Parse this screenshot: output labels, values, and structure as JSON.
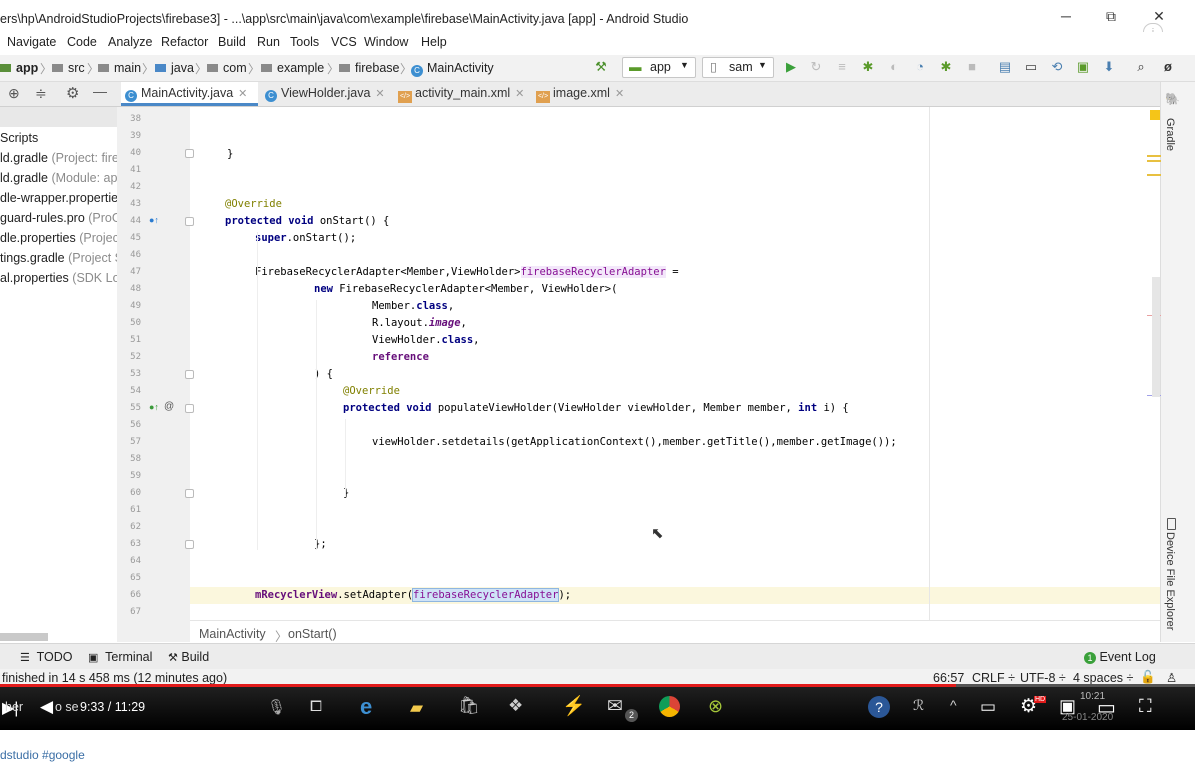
{
  "window": {
    "title": "ers\\hp\\AndroidStudioProjects\\firebase3] - ...\\app\\src\\main\\java\\com\\example\\firebase\\MainActivity.java [app] - Android Studio",
    "minimize": "─",
    "restore": "⧉",
    "close": "✕"
  },
  "menu": [
    "Navigate",
    "Code",
    "Analyze",
    "Refactor",
    "Build",
    "Run",
    "Tools",
    "VCS",
    "Window",
    "Help"
  ],
  "breadcrumb": {
    "items": [
      "app",
      "src",
      "main",
      "java",
      "com",
      "example",
      "firebase",
      "MainActivity"
    ]
  },
  "toolbar": {
    "run_config": "app",
    "device": "sam"
  },
  "tabs": [
    {
      "label": "MainActivity.java",
      "active": true
    },
    {
      "label": "ViewHolder.java",
      "active": false
    },
    {
      "label": "activity_main.xml",
      "active": false
    },
    {
      "label": "image.xml",
      "active": false
    }
  ],
  "project_panel": {
    "items": [
      {
        "name": "Scripts",
        "note": ""
      },
      {
        "name": "ld.gradle",
        "note": "(Project: fireb"
      },
      {
        "name": "ld.gradle",
        "note": "(Module: app"
      },
      {
        "name": "dle-wrapper.propertie",
        "note": ""
      },
      {
        "name": "guard-rules.pro",
        "note": "(ProG"
      },
      {
        "name": "dle.properties",
        "note": "(Project"
      },
      {
        "name": "tings.gradle",
        "note": "(Project Se"
      },
      {
        "name": "al.properties",
        "note": "(SDK Loc"
      }
    ]
  },
  "gutter": {
    "line_numbers": [
      "38",
      "39",
      "40",
      "41",
      "42",
      "43",
      "44",
      "45",
      "46",
      "47",
      "48",
      "49",
      "50",
      "51",
      "52",
      "53",
      "54",
      "55",
      "56",
      "57",
      "58",
      "59",
      "60",
      "61",
      "62",
      "63",
      "64",
      "65",
      "66",
      "67"
    ]
  },
  "code": {
    "l40": "}",
    "l43": "@Override",
    "l44_kw": "protected void",
    "l44_rest": " onStart() {",
    "l45_kw": "super",
    "l45_rest": ".onStart();",
    "l47_a": "FirebaseRecyclerAdapter<Member,ViewHolder>",
    "l47_var": "firebaseRecyclerAdapter",
    "l47_b": " =",
    "l48_kw": "new",
    "l48_rest": " FirebaseRecyclerAdapter<Member, ViewHolder>(",
    "l49_a": "Member.",
    "l49_kw": "class",
    "l49_b": ",",
    "l50_a": "R.layout.",
    "l50_it": "image",
    "l50_b": ",",
    "l51_a": "ViewHolder.",
    "l51_kw": "class",
    "l51_b": ",",
    "l52": "reference",
    "l53": ") {",
    "l54": "@Override",
    "l55_kw": "protected void",
    "l55_a": " populateViewHolder(ViewHolder viewHolder, Member member, ",
    "l55_kw2": "int",
    "l55_b": " i) {",
    "l57": "viewHolder.setdetails(getApplicationContext(),member.getTitle(),member.getImage());",
    "l60": "}",
    "l63": "};",
    "l66_a": "mRecyclerView",
    "l66_b": ".setAdapter(",
    "l66_c": "firebaseRecyclerAdapter",
    "l66_d": ");"
  },
  "editor_breadcrumb": [
    "MainActivity",
    "onStart()"
  ],
  "right_strip": {
    "gradle": "Gradle",
    "device_file_explorer": "Device File Explorer"
  },
  "bottom_tools": [
    "TODO",
    "Terminal",
    "Build"
  ],
  "event_log": "Event Log",
  "status": {
    "message": "finished in 14 s 458 ms (12 minutes ago)",
    "position": "66:57",
    "line_sep": "CRLF ÷",
    "encoding": "UTF-8 ÷",
    "indent": "4 spaces ÷"
  },
  "video": {
    "time": "9:33 / 11:29",
    "overlay_text": "her",
    "overlay_text2": "o se",
    "progress_fraction": 0.8,
    "notification_count": "2",
    "clock": "10:21",
    "date": "25-01-2020"
  },
  "below": {
    "hashtags": "dstudio #google"
  }
}
